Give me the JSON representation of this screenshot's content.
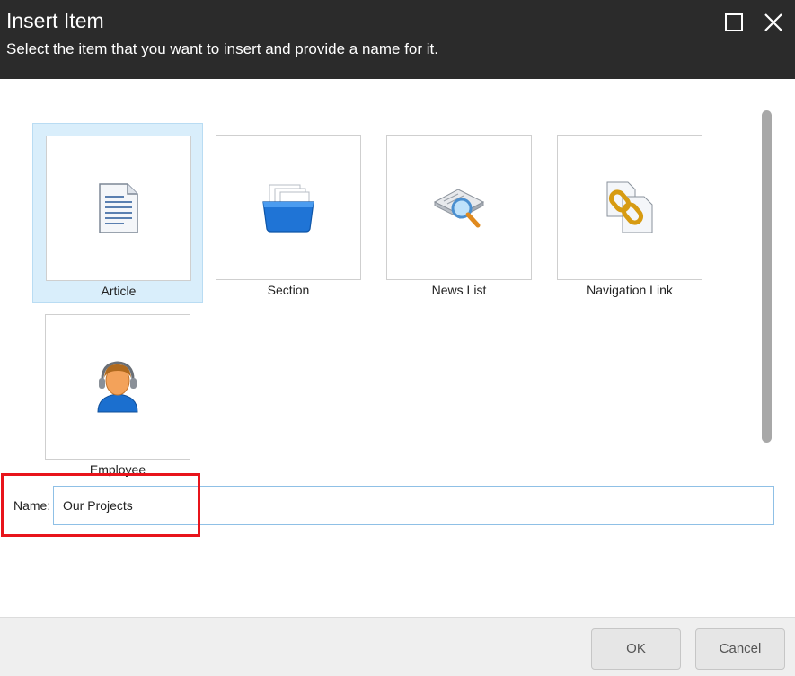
{
  "dialog": {
    "title": "Insert Item",
    "subtitle": "Select the item that you want to insert and provide a name for it."
  },
  "window_controls": {
    "maximize_icon": "maximize-icon",
    "close_icon": "close-icon"
  },
  "items": [
    {
      "label": "Article",
      "icon": "document-icon",
      "selected": true
    },
    {
      "label": "Section",
      "icon": "folder-icon",
      "selected": false
    },
    {
      "label": "News List",
      "icon": "newspaper-search-icon",
      "selected": false
    },
    {
      "label": "Navigation Link",
      "icon": "link-document-icon",
      "selected": false
    },
    {
      "label": "Employee",
      "icon": "user-headset-icon",
      "selected": false
    }
  ],
  "name_field": {
    "label": "Name:",
    "value": "Our Projects"
  },
  "buttons": {
    "ok": "OK",
    "cancel": "Cancel"
  },
  "colors": {
    "header_bg": "#2b2b2b",
    "selected_tile_bg": "#d9eefb",
    "highlight_border": "#e8141b",
    "input_border": "#8fc0e6"
  }
}
